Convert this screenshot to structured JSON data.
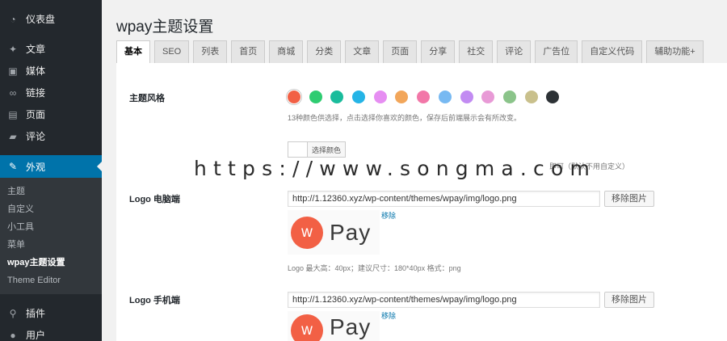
{
  "sidebar": {
    "items_top": [
      {
        "id": "dashboard",
        "label": "仪表盘",
        "icon": "dashboard-icon"
      },
      {
        "id": "posts",
        "label": "文章",
        "icon": "pin-icon"
      },
      {
        "id": "media",
        "label": "媒体",
        "icon": "media-icon"
      },
      {
        "id": "links",
        "label": "链接",
        "icon": "link-icon"
      },
      {
        "id": "pages",
        "label": "页面",
        "icon": "page-icon"
      },
      {
        "id": "comments",
        "label": "评论",
        "icon": "comment-icon"
      }
    ],
    "appearance": {
      "label": "外观",
      "icon": "paintbrush-icon"
    },
    "submenu": [
      {
        "label": "主题"
      },
      {
        "label": "自定义"
      },
      {
        "label": "小工具"
      },
      {
        "label": "菜单"
      },
      {
        "label": "wpay主题设置",
        "current": true
      },
      {
        "label": "Theme Editor"
      }
    ],
    "items_bottom": [
      {
        "id": "plugins",
        "label": "插件",
        "icon": "plugin-icon"
      },
      {
        "id": "users",
        "label": "用户",
        "icon": "user-icon"
      }
    ]
  },
  "page": {
    "title": "wpay主题设置"
  },
  "tabs": [
    "基本",
    "SEO",
    "列表",
    "首页",
    "商城",
    "分类",
    "文章",
    "页面",
    "分享",
    "社交",
    "评论",
    "广告位",
    "自定义代码",
    "辅助功能+"
  ],
  "active_tab": 0,
  "theme_style": {
    "label": "主题风格",
    "colors": [
      "#f26045",
      "#2ecc71",
      "#1abc9c",
      "#25b4e6",
      "#e68ef2",
      "#f2a65a",
      "#f277a8",
      "#77b9f2",
      "#c28bf2",
      "#e89ad6",
      "#8bc48a",
      "#c9c08c",
      "#2d3236"
    ],
    "selected_index": 0,
    "description": "13种颜色供选择，点击选择你喜欢的颜色，保存后前端展示会有所改变。",
    "choose_color_label": "选择颜色",
    "custom_hint_tail": "即可（默认不用自定义）"
  },
  "logo_pc": {
    "label": "Logo 电脑端",
    "url": "http://1.12360.xyz/wp-content/themes/wpay/img/logo.png",
    "button": "移除图片",
    "remove_link": "移除",
    "logo_mark": "w",
    "logo_text": "Pay",
    "hint": "Logo 最大高：40px；建议尺寸：180*40px 格式：png"
  },
  "logo_mobile": {
    "label": "Logo 手机端",
    "url": "http://1.12360.xyz/wp-content/themes/wpay/img/logo.png",
    "button": "移除图片",
    "remove_link": "移除",
    "logo_mark": "w",
    "logo_text": "Pay"
  },
  "watermark": "https://www.songma.com"
}
